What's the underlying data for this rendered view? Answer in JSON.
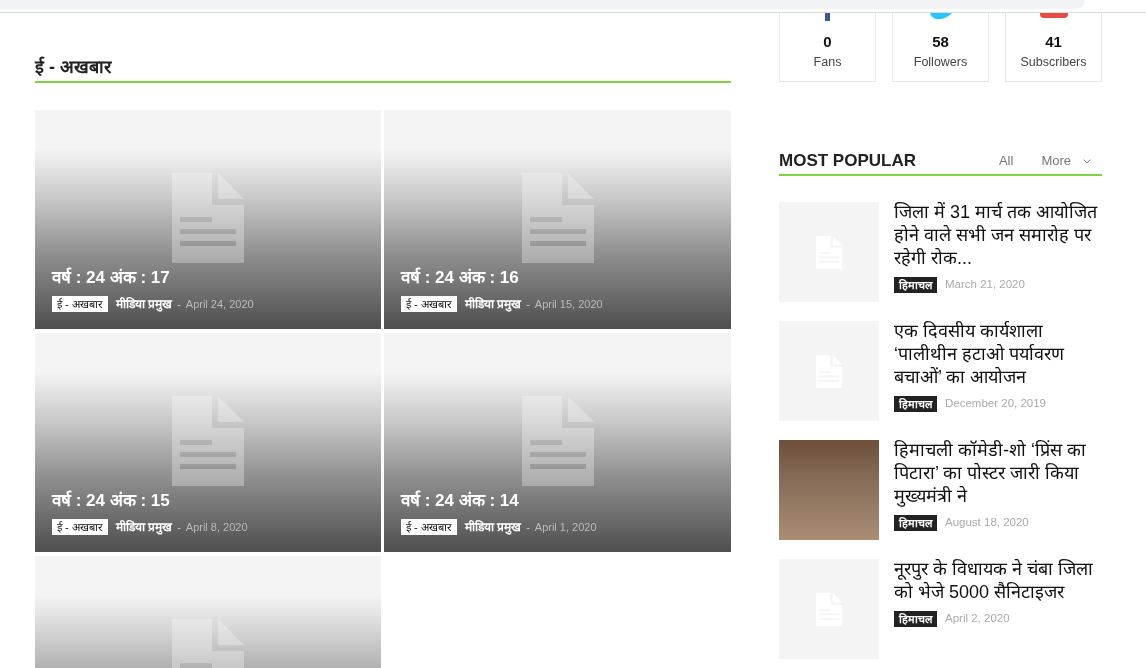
{
  "social_counters": [
    {
      "kind": "stem",
      "color": "#3b5998",
      "count": "0",
      "label": "Fans"
    },
    {
      "kind": "bird",
      "color": "#29c5f6",
      "count": "58",
      "label": "Followers"
    },
    {
      "kind": "tile",
      "color": "#e14e42",
      "count": "41",
      "label": "Subscribers"
    }
  ],
  "section": {
    "title": "ई - अखबार",
    "cards": [
      {
        "kind": "full",
        "title": "वर्ष : 24 अंक : 17",
        "category": "ई - अखबार",
        "author": "मीडिया प्रमुख",
        "separator": "-",
        "date": "April 24, 2020"
      },
      {
        "kind": "full",
        "title": "वर्ष : 24 अंक : 16",
        "category": "ई - अखबार",
        "author": "मीडिया प्रमुख",
        "separator": "-",
        "date": "April 15, 2020"
      },
      {
        "kind": "full",
        "title": "वर्ष : 24 अंक : 15",
        "category": "ई - अखबार",
        "author": "मीडिया प्रमुख",
        "separator": "-",
        "date": "April 8, 2020"
      },
      {
        "kind": "full",
        "title": "वर्ष : 24 अंक : 14",
        "category": "ई - अखबार",
        "author": "मीडिया प्रमुख",
        "separator": "-",
        "date": "April 1, 2020"
      },
      {
        "kind": "cropped"
      }
    ]
  },
  "most_popular": {
    "title": "MOST POPULAR",
    "filters": [
      {
        "label": "All",
        "dropdown": false
      },
      {
        "label": "More",
        "dropdown": true
      }
    ],
    "items": [
      {
        "kind": "placeholder",
        "title": "जिला में 31 मार्च तक आयोजित होने वाले सभी जन समारोह पर रहेगी रोक...",
        "category": "हिमाचल",
        "date": "March 21, 2020"
      },
      {
        "kind": "placeholder",
        "title": "एक दिवसीय कार्यशाला ‘पालीथीन हटाओ पर्यावरण बचाओं’ का आयोजन",
        "category": "हिमाचल",
        "date": "December 20, 2019"
      },
      {
        "kind": "photo",
        "title": "हिमाचली कॉमेडी-शो ‘प्रिंस का पिटारा’ का पोस्टर जारी किया मुख्यमंत्री ने",
        "category": "हिमाचल",
        "date": "August 18, 2020"
      },
      {
        "kind": "placeholder",
        "title": "नूरपुर के विधायक ने चंबा जिला को भेजे 5000 सैनिटाइजर",
        "category": "हिमाचल",
        "date": "April 2, 2020"
      }
    ]
  }
}
